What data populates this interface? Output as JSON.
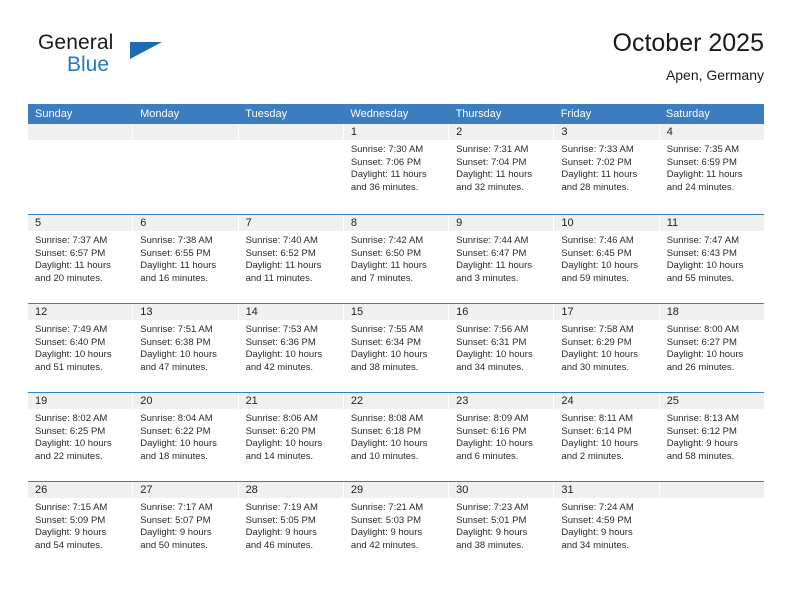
{
  "brand": {
    "name_top": "General",
    "name_bottom": "Blue",
    "accent_color": "#2279c4",
    "triangle_color": "#1b6cb4"
  },
  "header": {
    "title": "October 2025",
    "subtitle": "Apen, Germany"
  },
  "calendar": {
    "header_bg": "#3b7dbf",
    "daynum_bg": "#f0f0f0",
    "weekday_names": [
      "Sunday",
      "Monday",
      "Tuesday",
      "Wednesday",
      "Thursday",
      "Friday",
      "Saturday"
    ],
    "weeks": [
      [
        {
          "day": "",
          "empty": true
        },
        {
          "day": "",
          "empty": true
        },
        {
          "day": "",
          "empty": true
        },
        {
          "day": "1",
          "sunrise": "Sunrise: 7:30 AM",
          "sunset": "Sunset: 7:06 PM",
          "daylight1": "Daylight: 11 hours",
          "daylight2": "and 36 minutes."
        },
        {
          "day": "2",
          "sunrise": "Sunrise: 7:31 AM",
          "sunset": "Sunset: 7:04 PM",
          "daylight1": "Daylight: 11 hours",
          "daylight2": "and 32 minutes."
        },
        {
          "day": "3",
          "sunrise": "Sunrise: 7:33 AM",
          "sunset": "Sunset: 7:02 PM",
          "daylight1": "Daylight: 11 hours",
          "daylight2": "and 28 minutes."
        },
        {
          "day": "4",
          "sunrise": "Sunrise: 7:35 AM",
          "sunset": "Sunset: 6:59 PM",
          "daylight1": "Daylight: 11 hours",
          "daylight2": "and 24 minutes."
        }
      ],
      [
        {
          "day": "5",
          "sunrise": "Sunrise: 7:37 AM",
          "sunset": "Sunset: 6:57 PM",
          "daylight1": "Daylight: 11 hours",
          "daylight2": "and 20 minutes."
        },
        {
          "day": "6",
          "sunrise": "Sunrise: 7:38 AM",
          "sunset": "Sunset: 6:55 PM",
          "daylight1": "Daylight: 11 hours",
          "daylight2": "and 16 minutes."
        },
        {
          "day": "7",
          "sunrise": "Sunrise: 7:40 AM",
          "sunset": "Sunset: 6:52 PM",
          "daylight1": "Daylight: 11 hours",
          "daylight2": "and 11 minutes."
        },
        {
          "day": "8",
          "sunrise": "Sunrise: 7:42 AM",
          "sunset": "Sunset: 6:50 PM",
          "daylight1": "Daylight: 11 hours",
          "daylight2": "and 7 minutes."
        },
        {
          "day": "9",
          "sunrise": "Sunrise: 7:44 AM",
          "sunset": "Sunset: 6:47 PM",
          "daylight1": "Daylight: 11 hours",
          "daylight2": "and 3 minutes."
        },
        {
          "day": "10",
          "sunrise": "Sunrise: 7:46 AM",
          "sunset": "Sunset: 6:45 PM",
          "daylight1": "Daylight: 10 hours",
          "daylight2": "and 59 minutes."
        },
        {
          "day": "11",
          "sunrise": "Sunrise: 7:47 AM",
          "sunset": "Sunset: 6:43 PM",
          "daylight1": "Daylight: 10 hours",
          "daylight2": "and 55 minutes."
        }
      ],
      [
        {
          "day": "12",
          "sunrise": "Sunrise: 7:49 AM",
          "sunset": "Sunset: 6:40 PM",
          "daylight1": "Daylight: 10 hours",
          "daylight2": "and 51 minutes."
        },
        {
          "day": "13",
          "sunrise": "Sunrise: 7:51 AM",
          "sunset": "Sunset: 6:38 PM",
          "daylight1": "Daylight: 10 hours",
          "daylight2": "and 47 minutes."
        },
        {
          "day": "14",
          "sunrise": "Sunrise: 7:53 AM",
          "sunset": "Sunset: 6:36 PM",
          "daylight1": "Daylight: 10 hours",
          "daylight2": "and 42 minutes."
        },
        {
          "day": "15",
          "sunrise": "Sunrise: 7:55 AM",
          "sunset": "Sunset: 6:34 PM",
          "daylight1": "Daylight: 10 hours",
          "daylight2": "and 38 minutes."
        },
        {
          "day": "16",
          "sunrise": "Sunrise: 7:56 AM",
          "sunset": "Sunset: 6:31 PM",
          "daylight1": "Daylight: 10 hours",
          "daylight2": "and 34 minutes."
        },
        {
          "day": "17",
          "sunrise": "Sunrise: 7:58 AM",
          "sunset": "Sunset: 6:29 PM",
          "daylight1": "Daylight: 10 hours",
          "daylight2": "and 30 minutes."
        },
        {
          "day": "18",
          "sunrise": "Sunrise: 8:00 AM",
          "sunset": "Sunset: 6:27 PM",
          "daylight1": "Daylight: 10 hours",
          "daylight2": "and 26 minutes."
        }
      ],
      [
        {
          "day": "19",
          "sunrise": "Sunrise: 8:02 AM",
          "sunset": "Sunset: 6:25 PM",
          "daylight1": "Daylight: 10 hours",
          "daylight2": "and 22 minutes."
        },
        {
          "day": "20",
          "sunrise": "Sunrise: 8:04 AM",
          "sunset": "Sunset: 6:22 PM",
          "daylight1": "Daylight: 10 hours",
          "daylight2": "and 18 minutes."
        },
        {
          "day": "21",
          "sunrise": "Sunrise: 8:06 AM",
          "sunset": "Sunset: 6:20 PM",
          "daylight1": "Daylight: 10 hours",
          "daylight2": "and 14 minutes."
        },
        {
          "day": "22",
          "sunrise": "Sunrise: 8:08 AM",
          "sunset": "Sunset: 6:18 PM",
          "daylight1": "Daylight: 10 hours",
          "daylight2": "and 10 minutes."
        },
        {
          "day": "23",
          "sunrise": "Sunrise: 8:09 AM",
          "sunset": "Sunset: 6:16 PM",
          "daylight1": "Daylight: 10 hours",
          "daylight2": "and 6 minutes."
        },
        {
          "day": "24",
          "sunrise": "Sunrise: 8:11 AM",
          "sunset": "Sunset: 6:14 PM",
          "daylight1": "Daylight: 10 hours",
          "daylight2": "and 2 minutes."
        },
        {
          "day": "25",
          "sunrise": "Sunrise: 8:13 AM",
          "sunset": "Sunset: 6:12 PM",
          "daylight1": "Daylight: 9 hours",
          "daylight2": "and 58 minutes."
        }
      ],
      [
        {
          "day": "26",
          "sunrise": "Sunrise: 7:15 AM",
          "sunset": "Sunset: 5:09 PM",
          "daylight1": "Daylight: 9 hours",
          "daylight2": "and 54 minutes."
        },
        {
          "day": "27",
          "sunrise": "Sunrise: 7:17 AM",
          "sunset": "Sunset: 5:07 PM",
          "daylight1": "Daylight: 9 hours",
          "daylight2": "and 50 minutes."
        },
        {
          "day": "28",
          "sunrise": "Sunrise: 7:19 AM",
          "sunset": "Sunset: 5:05 PM",
          "daylight1": "Daylight: 9 hours",
          "daylight2": "and 46 minutes."
        },
        {
          "day": "29",
          "sunrise": "Sunrise: 7:21 AM",
          "sunset": "Sunset: 5:03 PM",
          "daylight1": "Daylight: 9 hours",
          "daylight2": "and 42 minutes."
        },
        {
          "day": "30",
          "sunrise": "Sunrise: 7:23 AM",
          "sunset": "Sunset: 5:01 PM",
          "daylight1": "Daylight: 9 hours",
          "daylight2": "and 38 minutes."
        },
        {
          "day": "31",
          "sunrise": "Sunrise: 7:24 AM",
          "sunset": "Sunset: 4:59 PM",
          "daylight1": "Daylight: 9 hours",
          "daylight2": "and 34 minutes."
        },
        {
          "day": "",
          "empty": true
        }
      ]
    ]
  }
}
